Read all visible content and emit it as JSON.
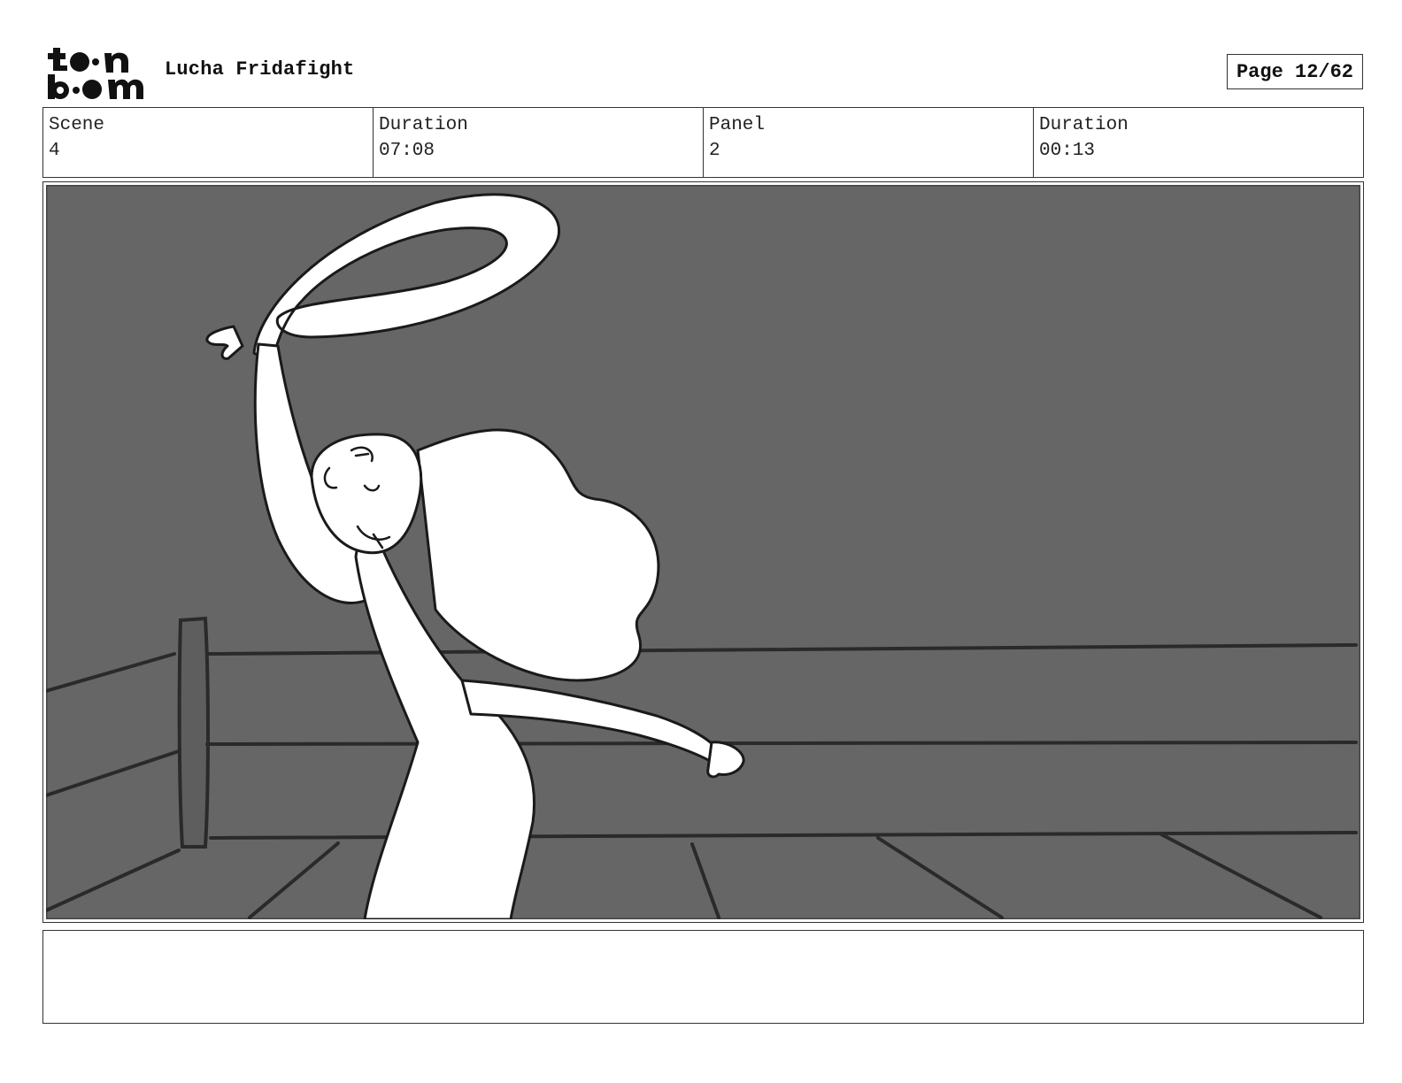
{
  "header": {
    "logo_text": "toon boom",
    "project_title": "Lucha Fridafight",
    "page_label": "Page 12/62"
  },
  "info": {
    "scene_label": "Scene",
    "scene_value": "4",
    "scene_duration_label": "Duration",
    "scene_duration_value": "07:08",
    "panel_label": "Panel",
    "panel_value": "2",
    "panel_duration_label": "Duration",
    "panel_duration_value": "00:13"
  },
  "panel": {
    "background_color": "#666666",
    "line_color": "#222222",
    "figure_color": "#ffffff"
  },
  "caption": {
    "text": ""
  }
}
